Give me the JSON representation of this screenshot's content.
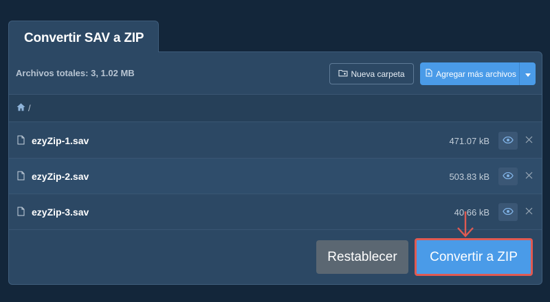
{
  "tab": {
    "title": "Convertir SAV a ZIP"
  },
  "toolbar": {
    "total_label": "Archivos totales: 3, 1.02 MB",
    "new_folder_label": "Nueva carpeta",
    "add_files_label": "Agregar más archivos"
  },
  "breadcrumb": {
    "path": "/"
  },
  "files": [
    {
      "name": "ezyZip-1.sav",
      "size": "471.07 kB"
    },
    {
      "name": "ezyZip-2.sav",
      "size": "503.83 kB"
    },
    {
      "name": "ezyZip-3.sav",
      "size": "40.66 kB"
    }
  ],
  "footer": {
    "reset_label": "Restablecer",
    "convert_label": "Convertir a ZIP"
  },
  "icons": {
    "folder_plus": "folder-plus-icon",
    "file_plus": "file-plus-icon",
    "caret_down": "caret-down-icon",
    "home": "home-icon",
    "file": "file-icon",
    "eye": "eye-icon",
    "close": "close-icon",
    "arrow_down": "arrow-down-icon"
  },
  "colors": {
    "background": "#13263a",
    "panel": "#2c4864",
    "primary": "#4a9be8",
    "secondary": "#5b6772",
    "highlight": "#e05a52"
  }
}
